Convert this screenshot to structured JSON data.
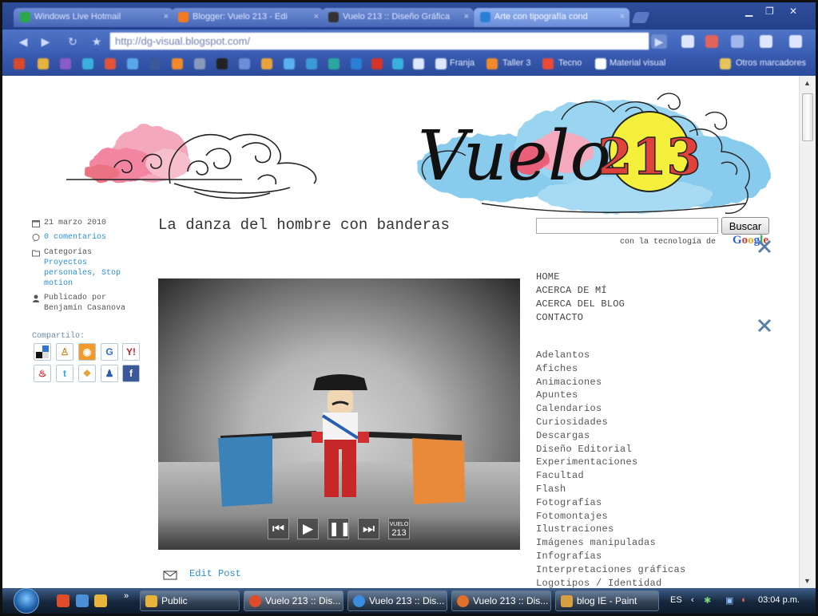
{
  "browser": {
    "tabs": [
      {
        "label": "Windows Live Hotmail",
        "color": "#2aa84a",
        "active": false
      },
      {
        "label": "Blogger: Vuelo 213 - Edi",
        "color": "#f47a20",
        "active": false
      },
      {
        "label": "Vuelo 213 :: Diseño Gráfica",
        "color": "#333333",
        "active": false
      },
      {
        "label": "Arte con tipografía cond",
        "color": "#2a7fd5",
        "active": true
      }
    ],
    "url": "http://dg-visual.blogspot.com/",
    "bookmarks": {
      "labels": [
        "Franja",
        "Taller 3",
        "Tecno",
        "Material visual"
      ],
      "other": "Otros marcadores"
    }
  },
  "blog": {
    "logo_text": "Vuelo",
    "logo_number": "213",
    "post": {
      "title": "La danza del hombre con banderas",
      "date": "21 marzo 2010",
      "comments": "0 comentarios",
      "categories_label": "Categorías",
      "categories": "Proyectos personales, Stop motion",
      "published_by": "Publicado por",
      "author": "Benjamín Casanova",
      "share_label": "Compartilo:",
      "edit_label": "Edit Post"
    },
    "video": {
      "controls": [
        "previous-icon",
        "play-icon",
        "pause-icon",
        "next-icon"
      ],
      "badge_top": "VUELO",
      "badge_bottom": "213"
    },
    "search": {
      "button": "Buscar",
      "powered": "con la tecnología de",
      "google": "Google"
    },
    "nav": [
      "HOME",
      "ACERCA DE MÍ",
      "ACERCA DEL BLOG",
      "CONTACTO"
    ],
    "categories": [
      "Adelantos",
      "Afiches",
      "Animaciones",
      "Apuntes",
      "Calendarios",
      "Curiosidades",
      "Descargas",
      "Diseño Editorial",
      "Experimentaciones",
      "Facultad",
      "Flash",
      "Fotografías",
      "Fotomontajes",
      "Ilustraciones",
      "Imágenes manipuladas",
      "Infografías",
      "Interpretaciones gráficas",
      "Logotipos / Identidad"
    ]
  },
  "taskbar": {
    "tasks": [
      {
        "label": "Public",
        "color": "#e8b33a"
      },
      {
        "label": "Vuelo 213 :: Dis...",
        "color": "#e04b2a"
      },
      {
        "label": "Vuelo 213 :: Dis...",
        "color": "#3b8de0"
      },
      {
        "label": "Vuelo 213 :: Dis...",
        "color": "#e0702a"
      },
      {
        "label": "blog IE - Paint",
        "color": "#d8a040"
      }
    ],
    "language": "ES",
    "clock": "03:04 p.m."
  }
}
